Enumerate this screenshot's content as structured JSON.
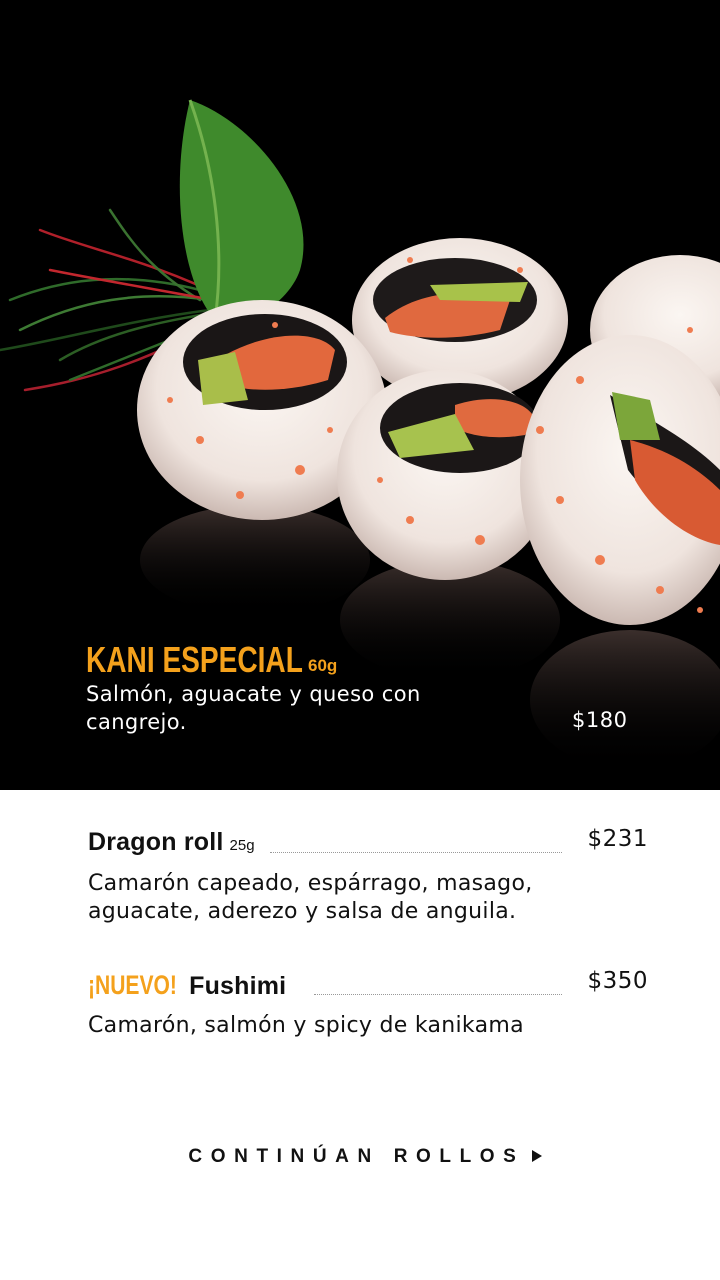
{
  "hero": {
    "title": "KANI ESPECIAL",
    "weight": "60g",
    "description": "Salmón, aguacate y queso con cangrejo.",
    "price": "$180",
    "image": "sushi-rolls-photo"
  },
  "items": [
    {
      "badge": "",
      "name": "Dragon roll",
      "weight": "25g",
      "price": "$231",
      "description": "Camarón capeado, espárrago, masago, aguacate, aderezo y salsa de anguila."
    },
    {
      "badge": "¡NUEVO!",
      "name": "Fushimi",
      "weight": "",
      "price": "$350",
      "description": "Camarón, salmón y spicy de kanikama"
    }
  ],
  "footer": {
    "continue_label": "CONTINÚAN ROLLOS",
    "continue_icon": "play-arrow-icon"
  },
  "colors": {
    "accent": "#f4a11c",
    "hero_bg": "#000000",
    "text": "#111111"
  }
}
